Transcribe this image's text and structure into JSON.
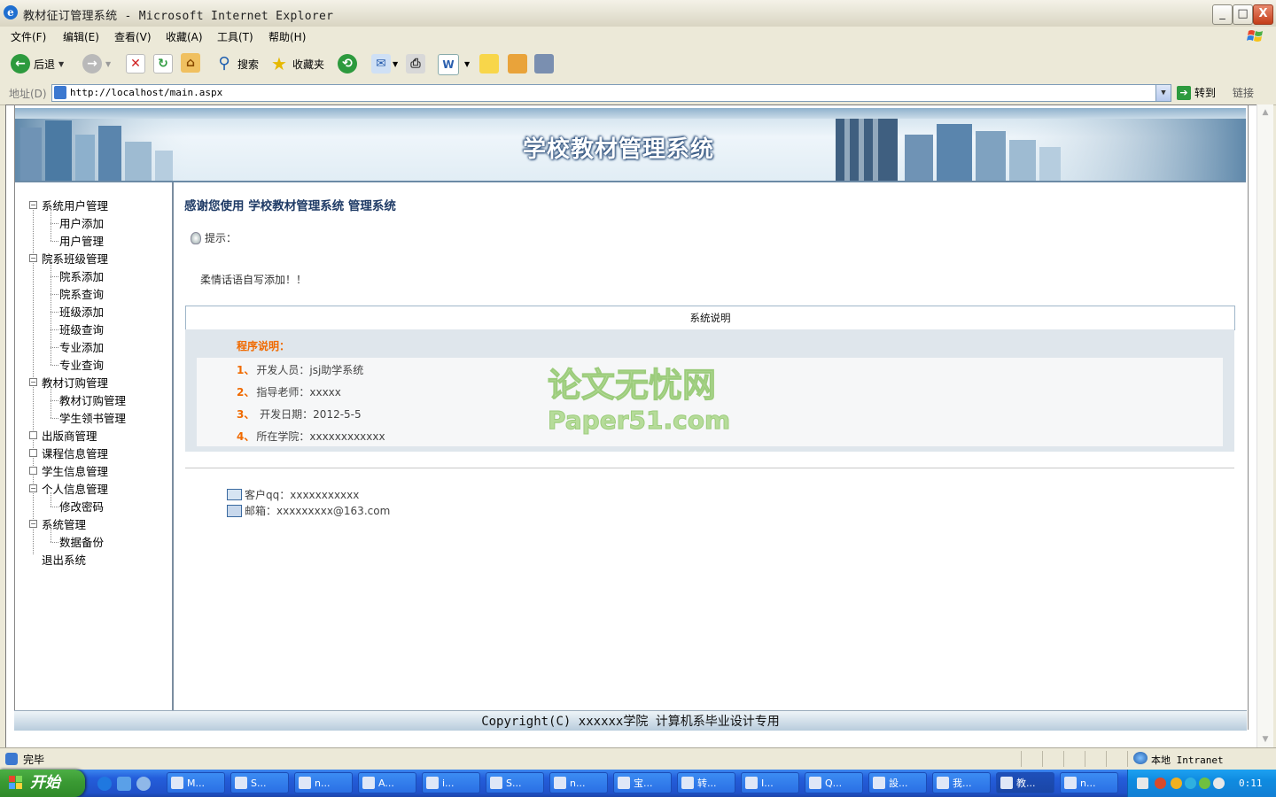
{
  "window": {
    "title": "教材征订管理系统 - Microsoft Internet Explorer",
    "controls": {
      "minimize": "_",
      "maximize": "□",
      "close": "X"
    }
  },
  "menu": [
    "文件(F)",
    "编辑(E)",
    "查看(V)",
    "收藏(A)",
    "工具(T)",
    "帮助(H)"
  ],
  "toolbar": {
    "back": "后退",
    "search": "搜索",
    "favorites": "收藏夹"
  },
  "address": {
    "label": "地址(D)",
    "url": "http://localhost/main.aspx",
    "go": "转到",
    "links": "链接"
  },
  "page": {
    "banner_title": "学校教材管理系统",
    "nav": [
      {
        "label": "系统用户管理",
        "expanded": true,
        "children": [
          "用户添加",
          "用户管理"
        ]
      },
      {
        "label": "院系班级管理",
        "expanded": true,
        "children": [
          "院系添加",
          "院系查询",
          "班级添加",
          "班级查询",
          "专业添加",
          "专业查询"
        ]
      },
      {
        "label": "教材订购管理",
        "expanded": true,
        "children": [
          "教材订购管理",
          "学生领书管理"
        ]
      },
      {
        "label": "出版商管理",
        "expanded": false,
        "children": []
      },
      {
        "label": "课程信息管理",
        "expanded": false,
        "children": []
      },
      {
        "label": "学生信息管理",
        "expanded": false,
        "children": []
      },
      {
        "label": "个人信息管理",
        "expanded": true,
        "children": [
          "修改密码"
        ]
      },
      {
        "label": "系统管理",
        "expanded": true,
        "children": [
          "数据备份"
        ]
      },
      {
        "label": "退出系统",
        "expanded": false,
        "children": []
      }
    ],
    "welcome": "感谢您使用 学校教材管理系统 管理系统",
    "tip_label": "提示：",
    "tip_message": "柔情话语自写添加！！",
    "system_box_title": "系统说明",
    "info_heading": "程序说明：",
    "info_rows": [
      {
        "num": "1、",
        "text": "开发人员：jsj助学系统"
      },
      {
        "num": "2、",
        "text": "指导老师：xxxxx"
      },
      {
        "num": "3、",
        "text": " 开发日期：2012-5-5"
      },
      {
        "num": "4、",
        "text": "所在学院：xxxxxxxxxxxx"
      }
    ],
    "watermark": {
      "line1": "论文无忧网",
      "line2": "Paper51.com"
    },
    "contact_qq": "客户qq：xxxxxxxxxxx",
    "contact_email": "邮箱：xxxxxxxxx@163.com",
    "footer": "Copyright(C) xxxxxx学院 计算机系毕业设计专用"
  },
  "status": {
    "text": "完毕",
    "zone": "本地 Intranet"
  },
  "taskbar": {
    "start": "开始",
    "tasks": [
      "M...",
      "S...",
      "n...",
      "A...",
      "i...",
      "S...",
      "n...",
      "宝...",
      "转...",
      "I...",
      "Q...",
      "設...",
      "我...",
      "教...",
      "n..."
    ],
    "active_task_index": 13,
    "clock": "0:11"
  },
  "colors": {
    "accent_orange": "#f06a00",
    "welcome_blue": "#1f3b66",
    "taskbar_blue": "#245edb",
    "start_green": "#3a9a33"
  }
}
